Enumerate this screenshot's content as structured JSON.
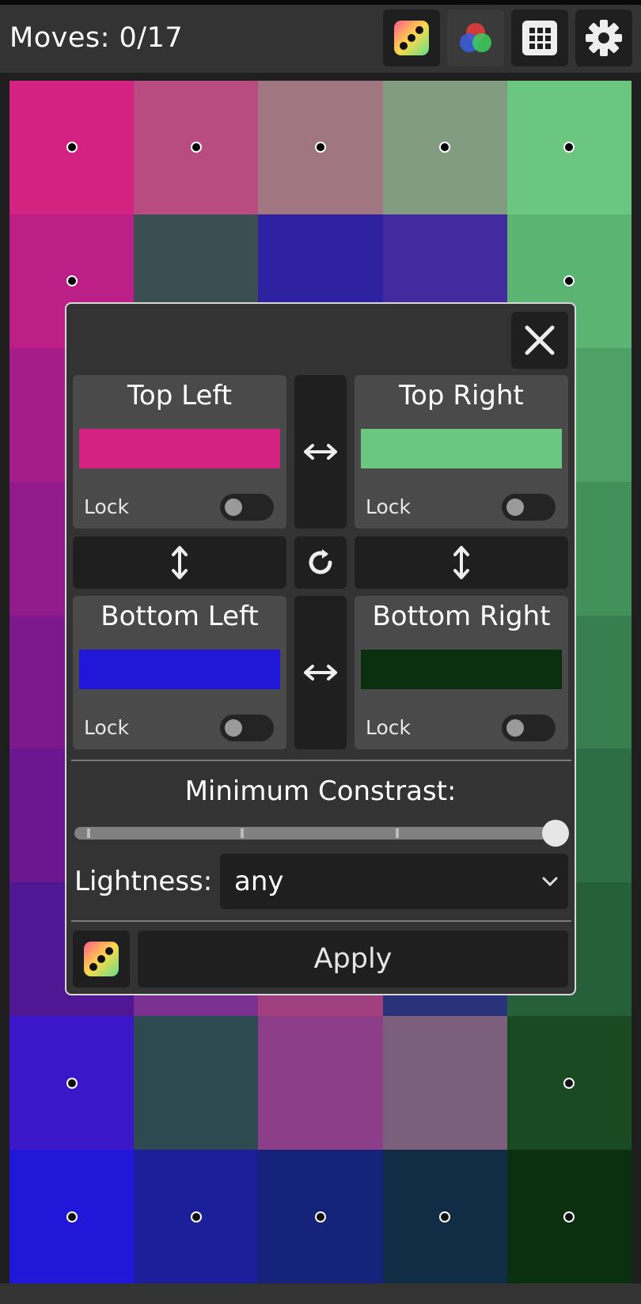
{
  "header": {
    "moves_label": "Moves: 0/17",
    "buttons": [
      {
        "name": "randomize-button",
        "icon": "dice-icon"
      },
      {
        "name": "color-mode-button",
        "icon": "rgb-circles-icon"
      },
      {
        "name": "grid-size-button",
        "icon": "grid-icon"
      },
      {
        "name": "settings-button",
        "icon": "gear-icon"
      }
    ]
  },
  "board": {
    "columns": 5,
    "rows": 9,
    "tiles": [
      [
        "#d42283",
        "#b84b80",
        "#a07680",
        "#819c80",
        "#6bc680"
      ],
      [
        "#bc1f85",
        "#3b4f52",
        "#2e22a0",
        "#432b9f",
        "#5cb472"
      ],
      [
        "#a51d88",
        null,
        null,
        null,
        "#4ea066"
      ],
      [
        "#911b8b",
        null,
        null,
        null,
        "#42905a"
      ],
      [
        "#7e198d",
        null,
        null,
        null,
        "#387f4f"
      ],
      [
        "#6a1790",
        null,
        null,
        null,
        "#2e6e44"
      ],
      [
        "#4f1794",
        "#7a3090",
        "#a0407f",
        "#2a3279",
        "#25603a"
      ],
      [
        "#3a18c9",
        "#2c4a50",
        "#8c3f88",
        "#7c5f7c",
        "#1a4a22"
      ],
      [
        "#2117d8",
        "#1c1f9a",
        "#15237a",
        "#112d45",
        "#0a3010"
      ]
    ],
    "dots_rows": [
      0,
      1,
      7,
      8
    ]
  },
  "dialog": {
    "corners": {
      "top_left": {
        "title": "Top Left",
        "color": "#d42283",
        "lock_label": "Lock",
        "locked": false
      },
      "top_right": {
        "title": "Top Right",
        "color": "#6bc680",
        "lock_label": "Lock",
        "locked": false
      },
      "bottom_left": {
        "title": "Bottom Left",
        "color": "#2117d8",
        "lock_label": "Lock",
        "locked": false
      },
      "bottom_right": {
        "title": "Bottom Right",
        "color": "#0a3010",
        "lock_label": "Lock",
        "locked": false
      }
    },
    "min_contrast_label": "Minimum Constrast:",
    "min_contrast_value": 1.0,
    "lightness_label": "Lightness:",
    "lightness_value": "any",
    "apply_label": "Apply"
  }
}
